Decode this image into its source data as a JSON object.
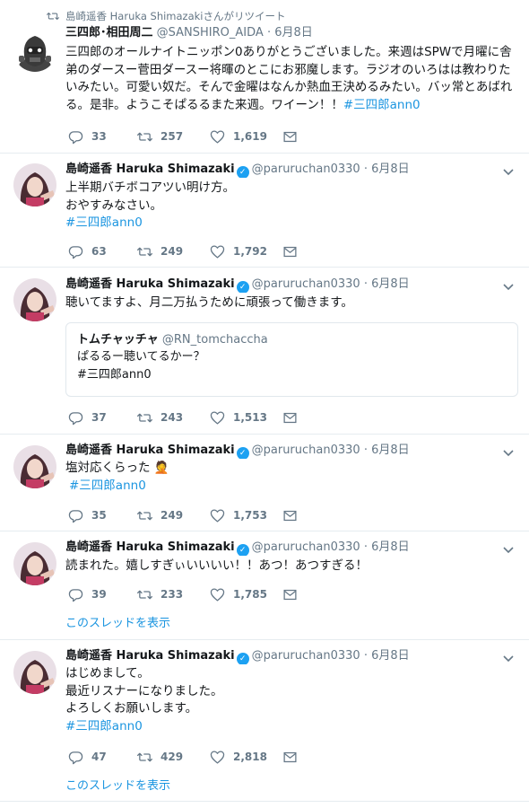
{
  "retweet_context": "島崎遥香 Haruka Shimazakiさんがリツイート",
  "show_thread_label": "このスレッドを表示",
  "colors": {
    "link": "#1b95e0",
    "verified": "#1da1f2",
    "meta": "#657786"
  },
  "icons": [
    "retweet-icon",
    "reply-icon",
    "heart-icon",
    "message-icon",
    "chevron-down-icon",
    "verified-icon"
  ],
  "tweets": [
    {
      "name": "三四郎･相田周二",
      "handle": "@SANSHIRO_AIDA",
      "dot": "·",
      "date": "6月8日",
      "text": "三四郎のオールナイトニッポン0ありがとうございました。来週はSPWで月曜に舎弟のダースー菅田ダースー将暉のとこにお邪魔します。ラジオのいろはは教わりたいみたい。可愛い奴だ。そんで金曜はなんか熱血王決めるみたい。バッ常とあばれる。是非。ようこそぱるるまた来週。ワイーン！！",
      "hashtag": "#三四郎ann0",
      "replies": "33",
      "retweets": "257",
      "likes": "1,619"
    },
    {
      "name": "島崎遥香 Haruka Shimazaki",
      "handle": "@paruruchan0330",
      "dot": "·",
      "date": "6月8日",
      "line1": "上半期バチボコアツい明け方。",
      "line2": "おやすみなさい。",
      "hashtag": "#三四郎ann0",
      "replies": "63",
      "retweets": "249",
      "likes": "1,792"
    },
    {
      "name": "島崎遥香 Haruka Shimazaki",
      "handle": "@paruruchan0330",
      "dot": "·",
      "date": "6月8日",
      "text": "聴いてますよ、月二万払うために頑張って働きます。",
      "quote": {
        "name": "トムチャッチャ",
        "handle": "@RN_tomchaccha",
        "line1": "ぱるるー聴いてるかー？",
        "line2": "#三四郎ann0"
      },
      "replies": "37",
      "retweets": "243",
      "likes": "1,513"
    },
    {
      "name": "島崎遥香 Haruka Shimazaki",
      "handle": "@paruruchan0330",
      "dot": "·",
      "date": "6月8日",
      "text": "塩対応くらった",
      "emoji": "🤦",
      "hashtag": "#三四郎ann0",
      "replies": "35",
      "retweets": "249",
      "likes": "1,753"
    },
    {
      "name": "島崎遥香 Haruka Shimazaki",
      "handle": "@paruruchan0330",
      "dot": "·",
      "date": "6月8日",
      "text": "読まれた。嬉しすぎぃいいいい！！あつ！あつすぎる！",
      "replies": "39",
      "retweets": "233",
      "likes": "1,785"
    },
    {
      "name": "島崎遥香 Haruka Shimazaki",
      "handle": "@paruruchan0330",
      "dot": "·",
      "date": "6月8日",
      "line1": "はじめまして。",
      "line2": "最近リスナーになりました。",
      "line3": "よろしくお願いします。",
      "hashtag": "#三四郎ann0",
      "replies": "47",
      "retweets": "429",
      "likes": "2,818"
    }
  ]
}
